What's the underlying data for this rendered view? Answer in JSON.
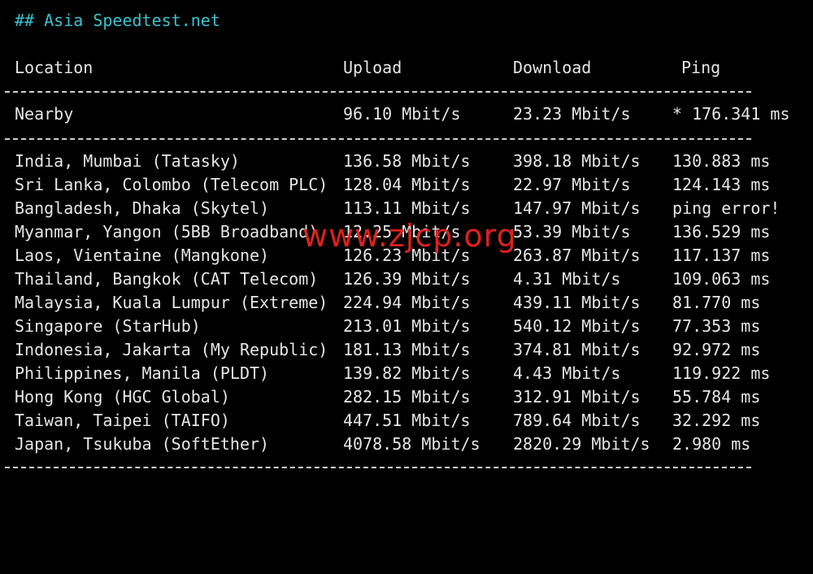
{
  "terminal": {
    "heading": "## Asia Speedtest.net",
    "columns": {
      "location": "Location",
      "upload": "Upload",
      "download": "Download",
      "ping": "Ping"
    },
    "nearby": {
      "location": "Nearby",
      "upload": "96.10 Mbit/s",
      "download": "23.23 Mbit/s",
      "ping": "* 176.341 ms"
    },
    "rows": [
      {
        "location": "India, Mumbai (Tatasky)",
        "upload": "136.58 Mbit/s",
        "download": "398.18 Mbit/s",
        "ping": "130.883 ms"
      },
      {
        "location": "Sri Lanka, Colombo (Telecom PLC)",
        "upload": "128.04 Mbit/s",
        "download": "22.97 Mbit/s",
        "ping": "124.143 ms"
      },
      {
        "location": "Bangladesh, Dhaka (Skytel)",
        "upload": "113.11 Mbit/s",
        "download": "147.97 Mbit/s",
        "ping": "ping error!"
      },
      {
        "location": "Myanmar, Yangon (5BB Broadband)",
        "upload": "12.25 Mbit/s",
        "download": "53.39 Mbit/s",
        "ping": "136.529 ms"
      },
      {
        "location": "Laos, Vientaine (Mangkone)",
        "upload": "126.23 Mbit/s",
        "download": "263.87 Mbit/s",
        "ping": "117.137 ms"
      },
      {
        "location": "Thailand, Bangkok (CAT Telecom)",
        "upload": "126.39 Mbit/s",
        "download": "4.31 Mbit/s",
        "ping": "109.063 ms"
      },
      {
        "location": "Malaysia, Kuala Lumpur (Extreme)",
        "upload": "224.94 Mbit/s",
        "download": "439.11 Mbit/s",
        "ping": "81.770 ms"
      },
      {
        "location": "Singapore (StarHub)",
        "upload": "213.01 Mbit/s",
        "download": "540.12 Mbit/s",
        "ping": "77.353 ms"
      },
      {
        "location": "Indonesia, Jakarta (My Republic)",
        "upload": "181.13 Mbit/s",
        "download": "374.81 Mbit/s",
        "ping": "92.972 ms"
      },
      {
        "location": "Philippines, Manila (PLDT)",
        "upload": "139.82 Mbit/s",
        "download": "4.43 Mbit/s",
        "ping": "119.922 ms"
      },
      {
        "location": "Hong Kong (HGC Global)",
        "upload": "282.15 Mbit/s",
        "download": "312.91 Mbit/s",
        "ping": "55.784 ms"
      },
      {
        "location": "Taiwan, Taipei (TAIFO)",
        "upload": "447.51 Mbit/s",
        "download": "789.64 Mbit/s",
        "ping": "32.292 ms"
      },
      {
        "location": "Japan, Tsukuba (SoftEther)",
        "upload": "4078.58 Mbit/s",
        "download": "2820.29 Mbit/s",
        "ping": "2.980 ms"
      }
    ]
  },
  "watermark": {
    "text": "www.zjcp.org",
    "color": "#e8231f"
  },
  "colors": {
    "background": "#000000",
    "text": "#e6e6e6",
    "heading": "#3bc1cf"
  }
}
